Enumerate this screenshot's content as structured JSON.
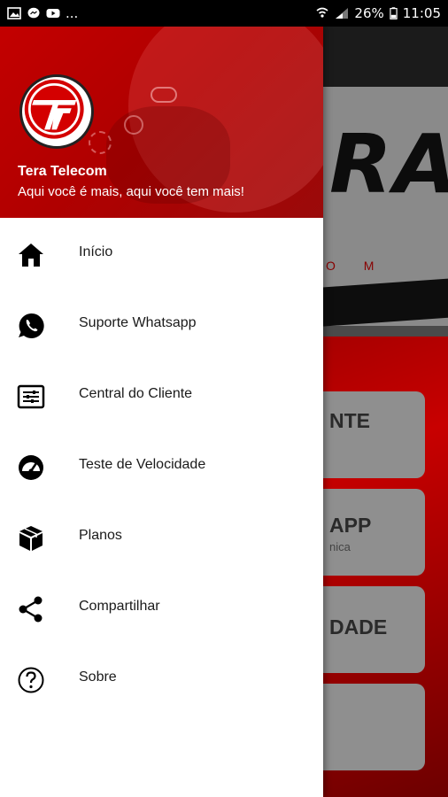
{
  "status_bar": {
    "battery": "26%",
    "time": "11:05",
    "left_icons": [
      "image-icon",
      "messenger-icon",
      "youtube-icon"
    ],
    "overflow": "..."
  },
  "background_app": {
    "logo_text": "RA",
    "logo_sub": "O M",
    "cards": [
      {
        "title": "NTE",
        "sub": ""
      },
      {
        "title": "APP",
        "sub": "nica"
      },
      {
        "title": "DADE",
        "sub": ""
      },
      {
        "title": "",
        "sub": ""
      }
    ]
  },
  "drawer": {
    "header": {
      "title": "Tera Telecom",
      "subtitle": "Aqui você é mais, aqui você tem mais!",
      "accent_color": "#c30000"
    },
    "items": [
      {
        "label": "Início",
        "icon": "home-icon"
      },
      {
        "label": "Suporte Whatsapp",
        "icon": "whatsapp-icon"
      },
      {
        "label": "Central do Cliente",
        "icon": "settings-panel-icon"
      },
      {
        "label": "Teste de Velocidade",
        "icon": "speedometer-icon"
      },
      {
        "label": "Planos",
        "icon": "box-icon"
      },
      {
        "label": "Compartilhar",
        "icon": "share-icon"
      },
      {
        "label": "Sobre",
        "icon": "help-circle-icon"
      }
    ]
  }
}
